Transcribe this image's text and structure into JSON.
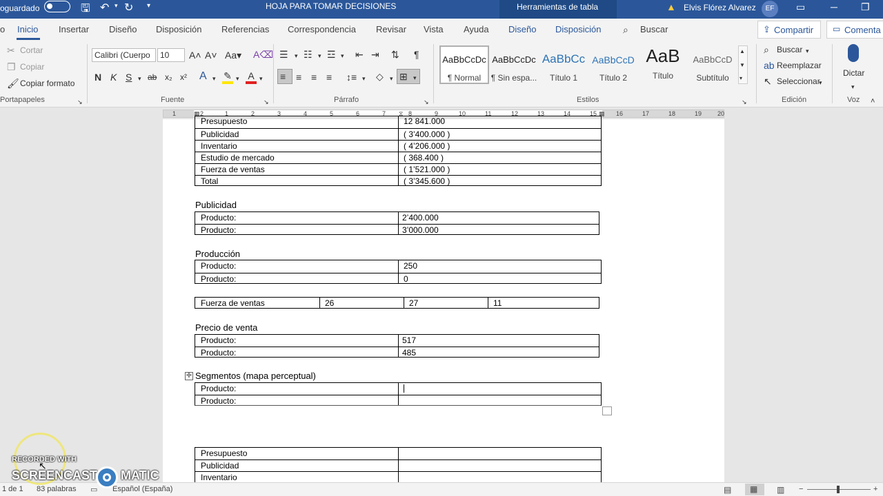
{
  "titlebar": {
    "autosave": "oguardado",
    "doc_title": "HOJA PARA TOMAR DECISIONES",
    "context_tools": "Herramientas de tabla",
    "user": "Elvis  Flórez Alvarez",
    "initials": "EF"
  },
  "tabs": [
    "o",
    "Inicio",
    "Insertar",
    "Diseño",
    "Disposición",
    "Referencias",
    "Correspondencia",
    "Revisar",
    "Vista",
    "Ayuda",
    "Diseño",
    "Disposición",
    "Buscar"
  ],
  "share": "Compartir",
  "comments": "Comenta",
  "clipboard": {
    "cut": "Cortar",
    "copy": "Copiar",
    "format": "Copiar formato",
    "group": "Portapapeles"
  },
  "font": {
    "name": "Calibri (Cuerpo",
    "size": "10",
    "group": "Fuente"
  },
  "paragraph": {
    "group": "Párrafo"
  },
  "styles": {
    "items": [
      {
        "preview": "AaBbCcDc",
        "name": "¶ Normal"
      },
      {
        "preview": "AaBbCcDc",
        "name": "¶ Sin espa..."
      },
      {
        "preview": "AaBbCc",
        "name": "Título 1"
      },
      {
        "preview": "AaBbCcD",
        "name": "Título 2"
      },
      {
        "preview": "AaB",
        "name": "Título"
      },
      {
        "preview": "AaBbCcD",
        "name": "Subtítulo"
      }
    ],
    "group": "Estilos"
  },
  "editing": {
    "find": "Buscar",
    "replace": "Reemplazar",
    "select": "Seleccionar",
    "group": "Edición"
  },
  "voice": {
    "dictate": "Dictar",
    "group": "Voz"
  },
  "ruler": [
    "1",
    "2",
    "1",
    "2",
    "3",
    "4",
    "5",
    "6",
    "7",
    "8",
    "9",
    "10",
    "11",
    "12",
    "13",
    "14",
    "15",
    "16",
    "17",
    "18",
    "19",
    "20"
  ],
  "doc": {
    "table1": [
      [
        "Presupuesto",
        "12 841.000"
      ],
      [
        "Publicidad",
        "(         3’400.000     )"
      ],
      [
        "Inventario",
        "(         4’206.000     )"
      ],
      [
        "Estudio de mercado",
        "(            368.400     )"
      ],
      [
        "Fuerza de ventas",
        "(         1’521.000     )"
      ],
      [
        "Total",
        "(         3’345.600     )"
      ]
    ],
    "publicidad_title": "Publicidad",
    "publicidad": [
      [
        "Producto:",
        "2’400.000"
      ],
      [
        "Producto:",
        "3’000.000"
      ]
    ],
    "produccion_title": "Producción",
    "produccion": [
      [
        "Producto:",
        "250"
      ],
      [
        "Producto:",
        "0"
      ]
    ],
    "fuerza": [
      "Fuerza de ventas",
      "26",
      "27",
      "11"
    ],
    "precio_title": "Precio de venta",
    "precio": [
      [
        "Producto:",
        "517"
      ],
      [
        "Producto:",
        "485"
      ]
    ],
    "segmentos_title": "Segmentos (mapa perceptual)",
    "segmentos": [
      [
        "Producto:",
        ""
      ],
      [
        "Producto:",
        ""
      ]
    ],
    "table_last": [
      [
        "Presupuesto",
        ""
      ],
      [
        "Publicidad",
        ""
      ],
      [
        "Inventario",
        ""
      ]
    ]
  },
  "status": {
    "page": "1 de 1",
    "words": "83 palabras",
    "lang": "Español (España)"
  },
  "watermark": {
    "line1": "RECORDED WITH",
    "line2a": "SCREENCAST",
    "line2b": "MATIC"
  },
  "colors": {
    "accent": "#2b579a"
  }
}
